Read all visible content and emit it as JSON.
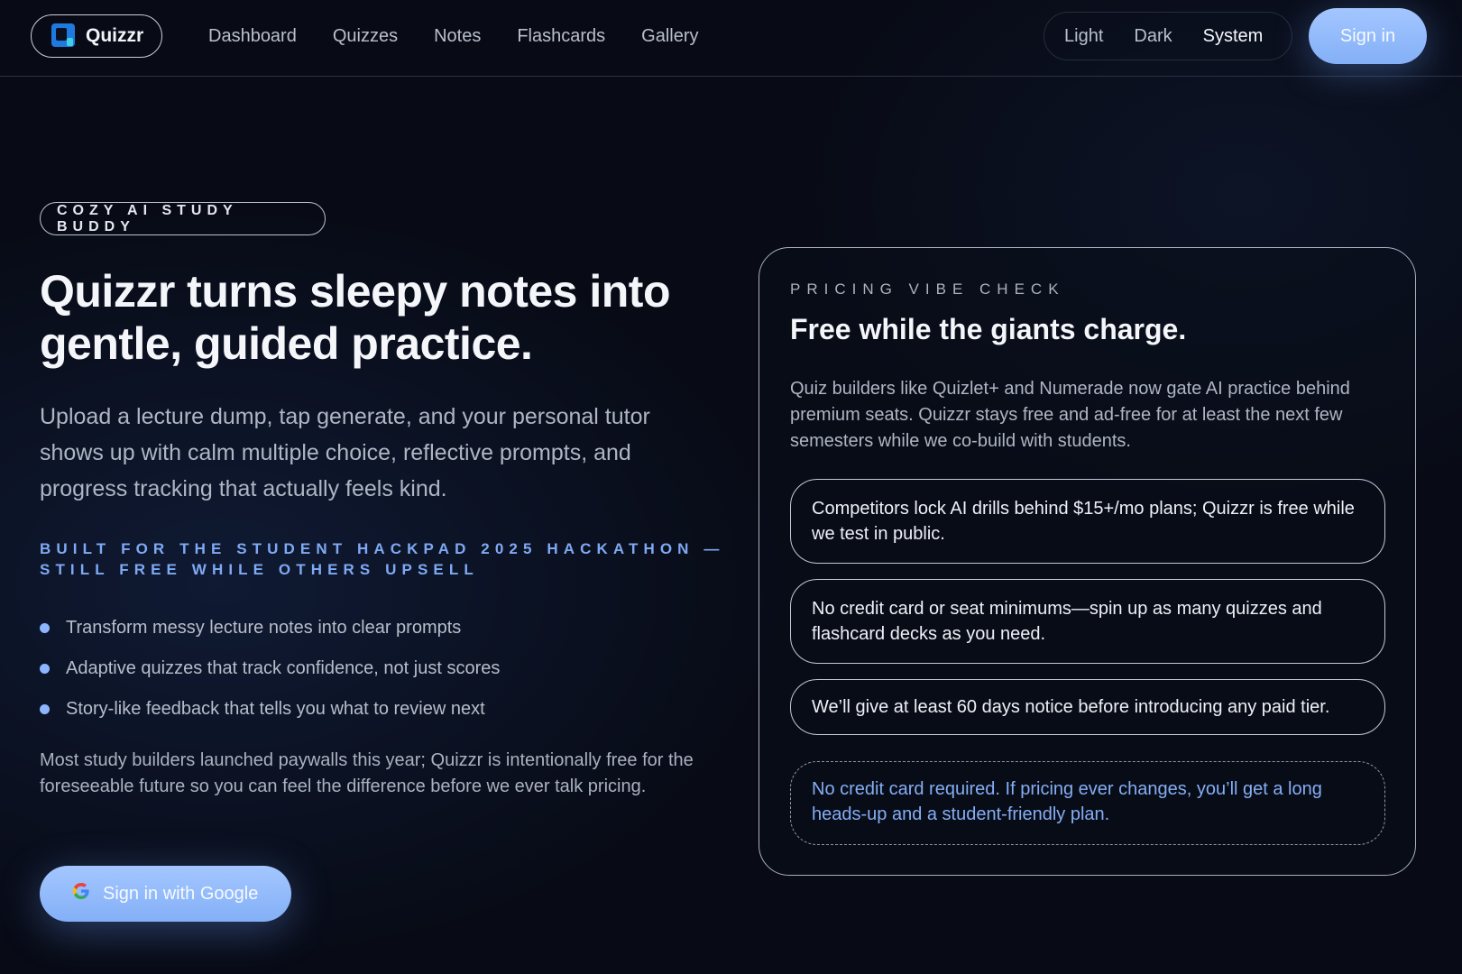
{
  "nav": {
    "brand": "Quizzr",
    "links": [
      "Dashboard",
      "Quizzes",
      "Notes",
      "Flashcards",
      "Gallery"
    ],
    "theme_options": [
      "Light",
      "Dark",
      "System"
    ],
    "signin_label": "Sign in"
  },
  "hero": {
    "badge": "COZY AI STUDY BUDDY",
    "title": "Quizzr turns sleepy notes into gentle, guided practice.",
    "subtitle": "Upload a lecture dump, tap generate, and your personal tutor shows up with calm multiple choice, reflective prompts, and progress tracking that actually feels kind.",
    "hackathon": "BUILT FOR THE STUDENT HACKPAD 2025 HACKATHON — STILL FREE WHILE OTHERS UPSELL",
    "bullets": [
      "Transform messy lecture notes into clear prompts",
      "Adaptive quizzes that track confidence, not just scores",
      "Story-like feedback that tells you what to review next"
    ],
    "footnote": "Most study builders launched paywalls this year; Quizzr is intentionally free for the foreseeable future so you can feel the difference before we ever talk pricing.",
    "google_label": "Sign in with Google"
  },
  "pricing": {
    "eyebrow": "PRICING VIBE CHECK",
    "title": "Free while the giants charge.",
    "description": "Quiz builders like Quizlet+ and Numerade now gate AI practice behind premium seats. Quizzr stays free and ad-free for at least the next few semesters while we co-build with students.",
    "points": [
      "Competitors lock AI drills behind $15+/mo plans; Quizzr is free while we test in public.",
      "No credit card or seat minimums—spin up as many quizzes and flashcard decks as you need.",
      "We’ll give at least 60 days notice before introducing any paid tier."
    ],
    "note": "No credit card required. If pricing ever changes, you’ll get a long heads-up and a student-friendly plan."
  },
  "colors": {
    "accent": "#8db5ff",
    "button": "#a3c6ff",
    "background": "#080b16"
  }
}
